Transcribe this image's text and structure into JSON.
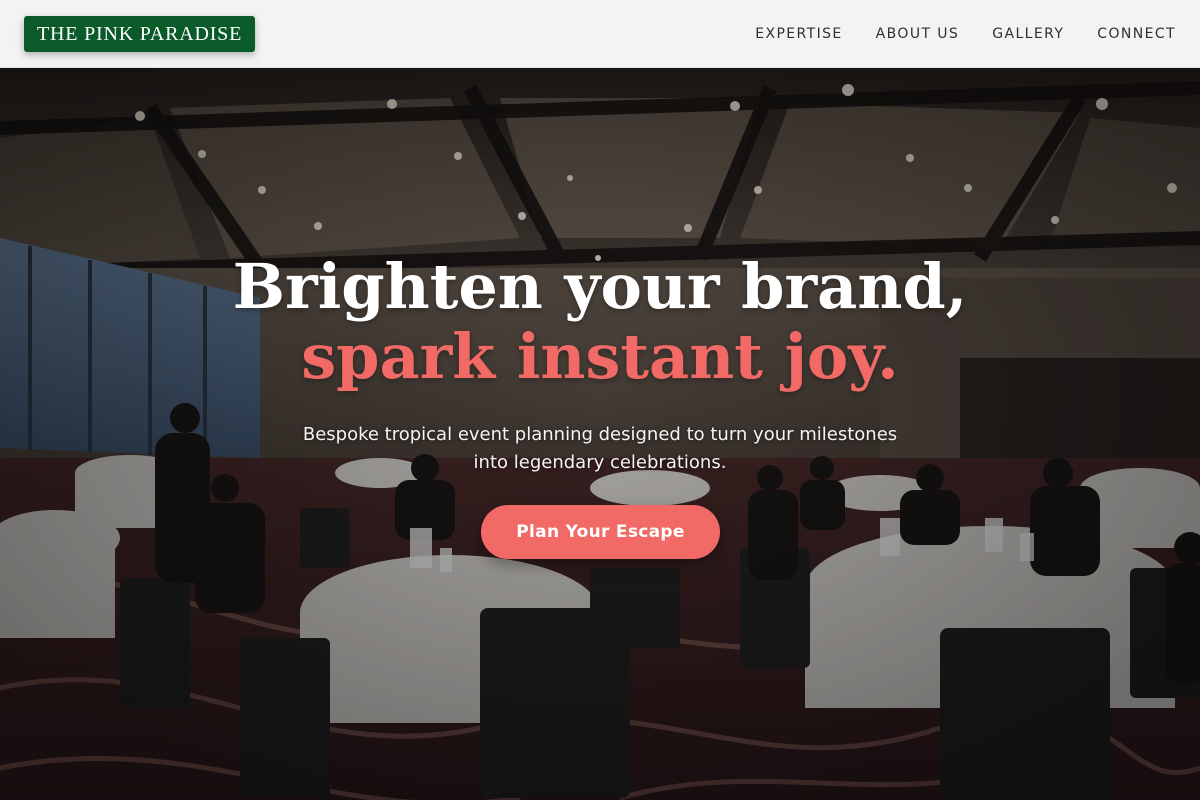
{
  "header": {
    "logo_text": "THE PINK PARADISE",
    "nav": [
      {
        "label": "EXPERTISE"
      },
      {
        "label": "ABOUT US"
      },
      {
        "label": "GALLERY"
      },
      {
        "label": "CONNECT"
      }
    ]
  },
  "hero": {
    "title_line1": "Brighten your brand,",
    "title_line2": "spark instant joy.",
    "subtitle_line1": "Bespoke tropical event planning designed to turn your milestones",
    "subtitle_line2": "into legendary celebrations.",
    "cta_label": "Plan Your Escape",
    "background_scene": "banquet-hall-photo"
  },
  "colors": {
    "logo_bg": "#0b5a2a",
    "accent_coral": "#f26a66",
    "header_bg": "#f3f3f3",
    "nav_text": "#2f2f2f"
  }
}
